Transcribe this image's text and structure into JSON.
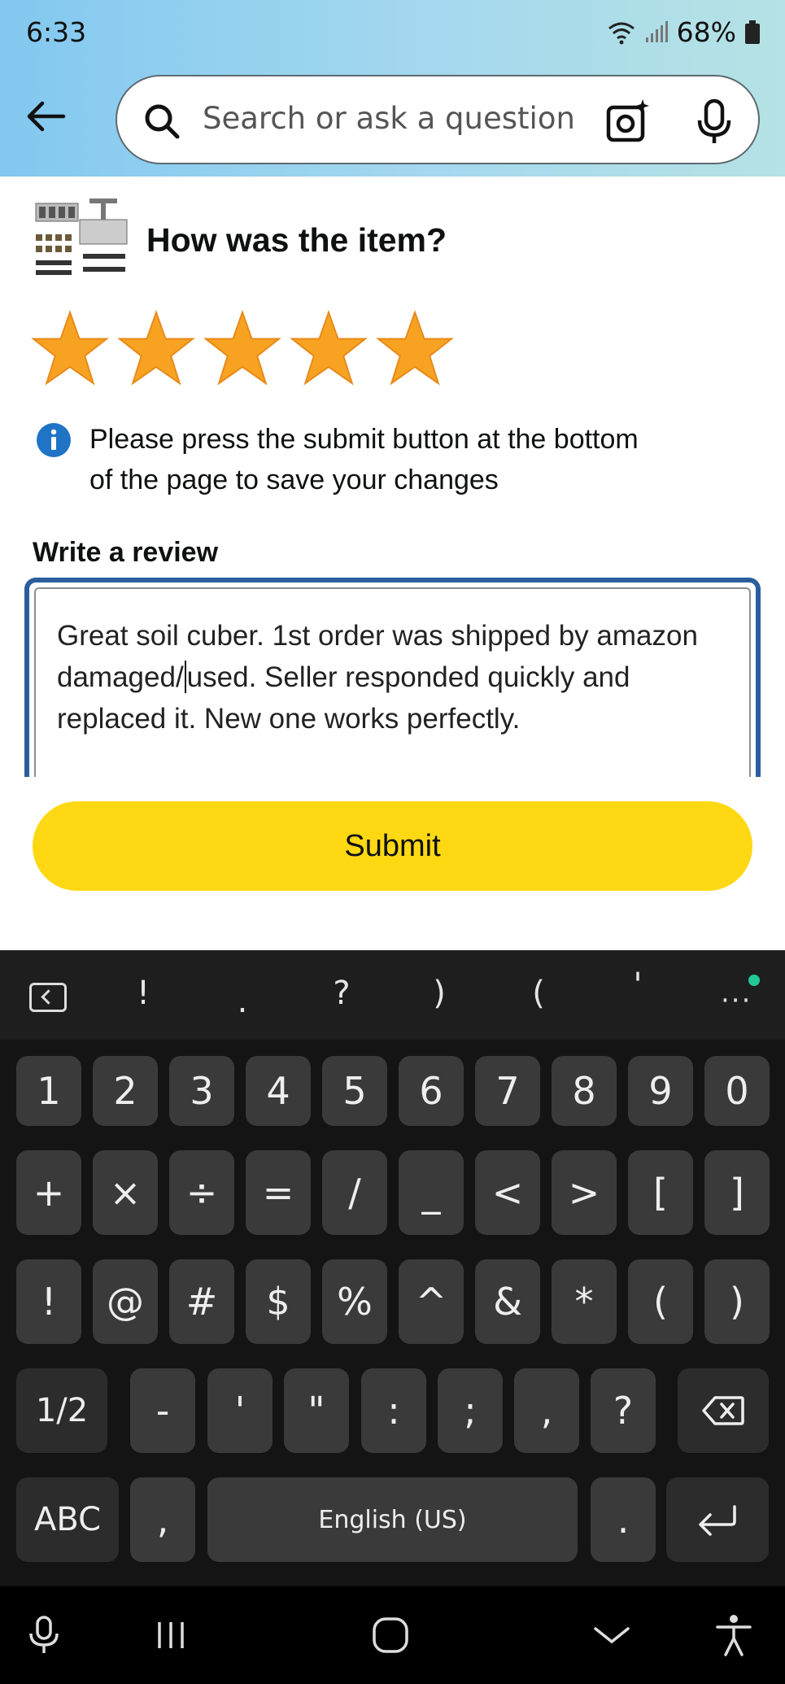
{
  "status_bar": {
    "time": "6:33",
    "battery": "68%"
  },
  "header": {
    "search_placeholder": "Search or ask a question"
  },
  "review": {
    "title": "How was the item?",
    "rating": 5,
    "max_rating": 5,
    "star_color": "#f7a221",
    "info_line1": "Please press the submit button at the bottom",
    "info_line2": "of the page to save your changes",
    "label": "Write a review",
    "text_before_cursor": "Great soil cuber. 1st order was shipped by amazon damaged/",
    "text_after_cursor": "used. Seller responded quickly and replaced it. New one works perfectly.",
    "submit_label": "Submit",
    "submit_color": "#ffd814"
  },
  "keyboard": {
    "toolbar": [
      "!",
      ".",
      "?",
      ")",
      "(",
      "'"
    ],
    "row1": [
      "1",
      "2",
      "3",
      "4",
      "5",
      "6",
      "7",
      "8",
      "9",
      "0"
    ],
    "row2": [
      "+",
      "×",
      "÷",
      "=",
      "/",
      "_",
      "<",
      ">",
      "[",
      "]"
    ],
    "row3": [
      "!",
      "@",
      "#",
      "$",
      "%",
      "^",
      "&",
      "*",
      "(",
      ")"
    ],
    "row4": [
      "1/2",
      "-",
      "'",
      "\"",
      ":",
      ";",
      ",",
      "?"
    ],
    "row5": {
      "abc": "ABC",
      "comma": ",",
      "space": "English (US)",
      "period": "."
    }
  },
  "icons": {
    "back": "arrow-left-icon",
    "search": "search-icon",
    "camera": "camera-sparkle-icon",
    "mic": "microphone-icon",
    "info": "info-icon",
    "backspace": "backspace-icon",
    "enter": "enter-icon"
  }
}
